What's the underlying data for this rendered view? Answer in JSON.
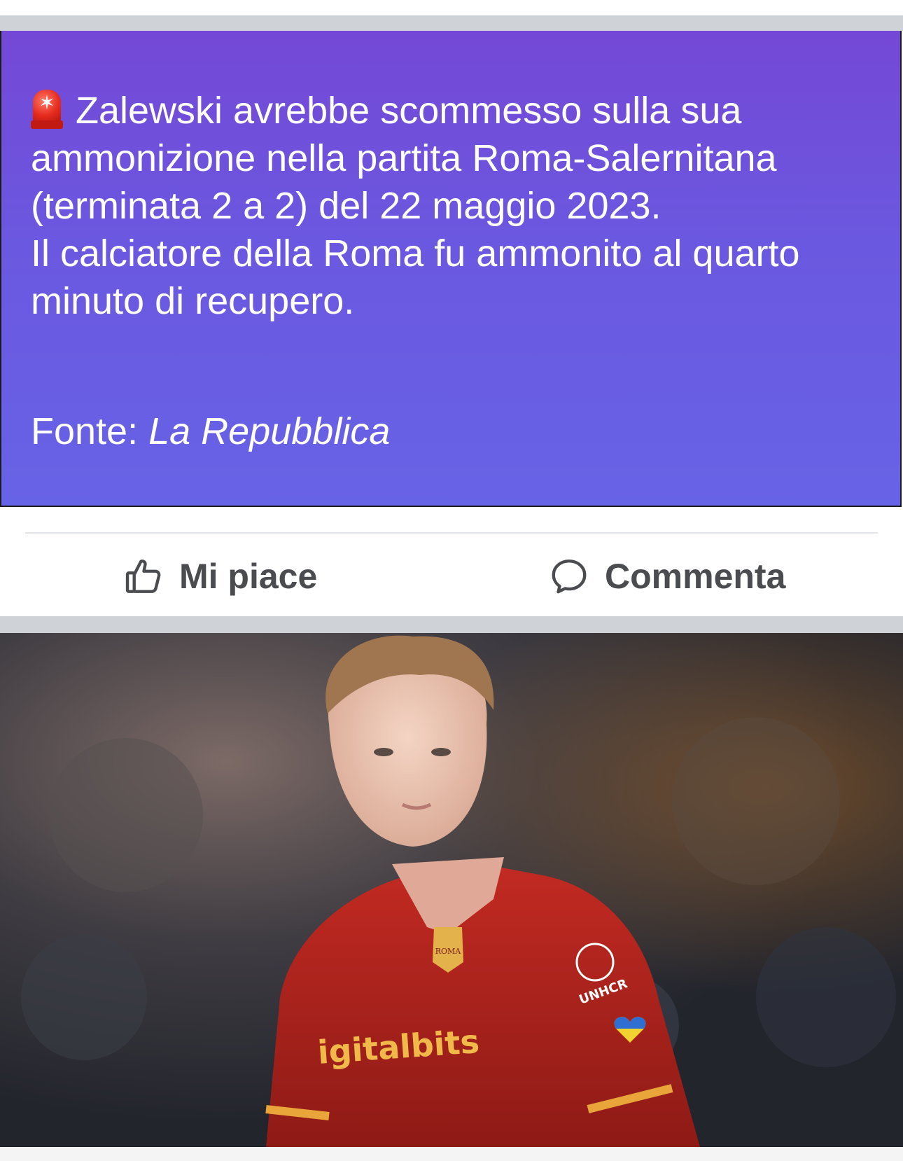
{
  "post": {
    "alert_icon": "police-light-icon",
    "lines": [
      "Zalewski avrebbe scommesso sulla sua",
      "ammonizione nella partita Roma-Salernitana",
      "(terminata 2 a 2) del 22 maggio 2023.",
      "Il calciatore della Roma fu ammonito al quarto",
      "minuto di recupero."
    ],
    "source_label": "Fonte:",
    "source_name": "La Repubblica",
    "background_colors": [
      "#7448d6",
      "#6763e6"
    ]
  },
  "actions": {
    "like_label": "Mi piace",
    "like_icon": "thumbs-up-icon",
    "comment_label": "Commenta",
    "comment_icon": "speech-bubble-icon"
  },
  "photo": {
    "jersey_text": "igitalbits",
    "sleeve_badge": "UNHCR",
    "crest_text": "ROMA"
  }
}
